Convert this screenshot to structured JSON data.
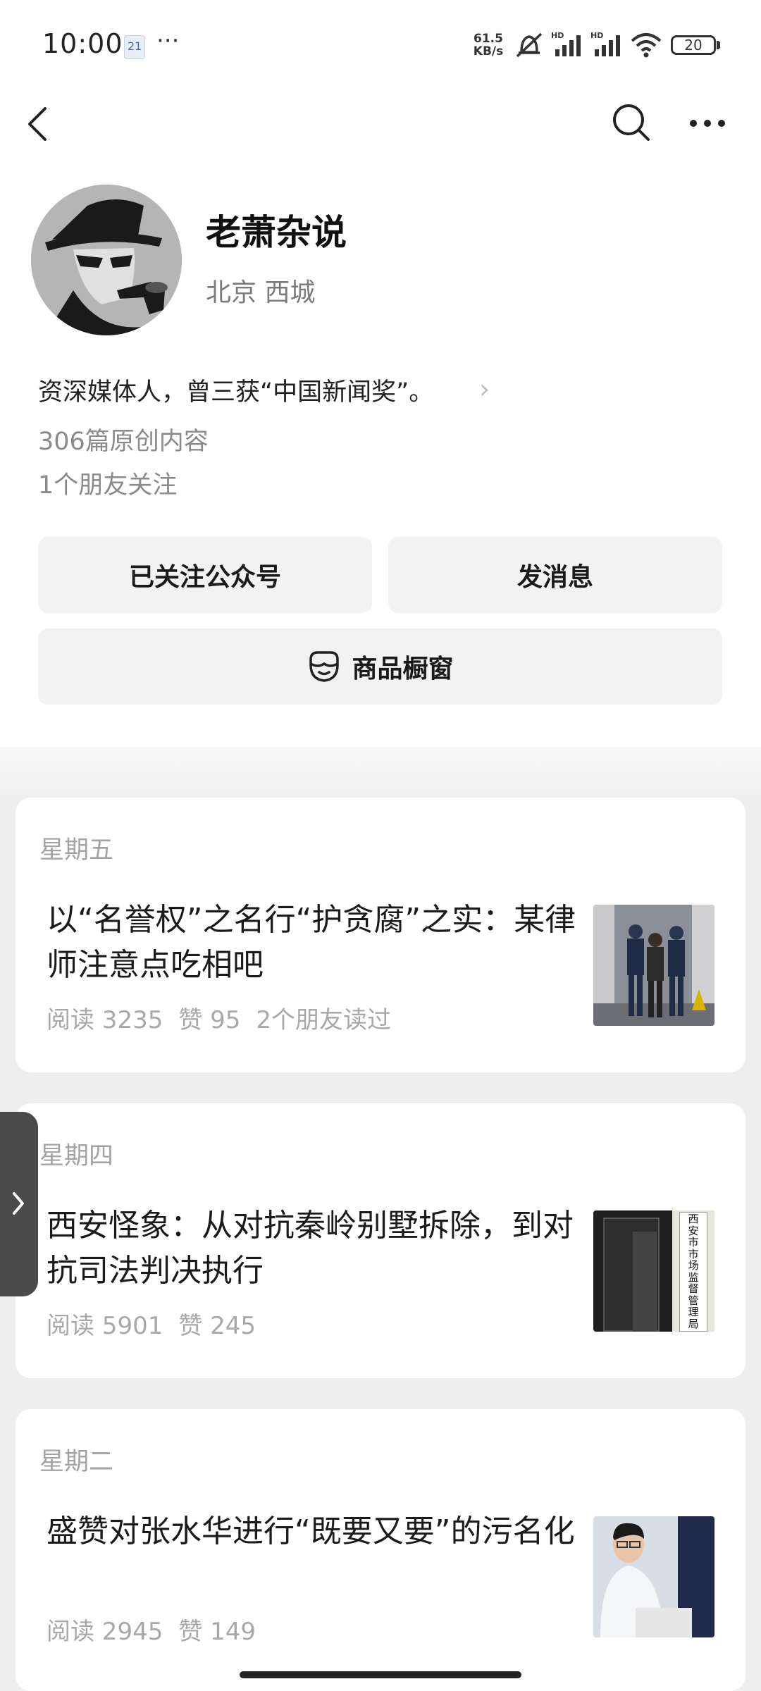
{
  "status_bar": {
    "time": "10:00",
    "calendar_badge": "21",
    "speed_top": "61.5",
    "speed_bottom": "KB/s",
    "battery": "20"
  },
  "profile": {
    "name": "老萧杂说",
    "location": "北京 西城",
    "bio": "资深媒体人，曾三获“中国新闻奖”。",
    "original_count": "306篇原创内容",
    "friends_follow": "1个朋友关注"
  },
  "actions": {
    "follow": "已关注公众号",
    "message": "发消息",
    "shop": "商品橱窗"
  },
  "articles": [
    {
      "day": "星期五",
      "title": "以“名誉权”之名行“护贪腐”之实：某律师注意点吃相吧",
      "reads": "阅读 3235",
      "likes": "赞 95",
      "friends": "2个朋友读过"
    },
    {
      "day": "星期四",
      "title": "西安怪象：从对抗秦岭别墅拆除，到对抗司法判决执行",
      "reads": "阅读 5901",
      "likes": "赞 245",
      "sign_text": "西安市市场监督管理局"
    },
    {
      "day": "星期二",
      "title": "盛赞对张水华进行“既要又要”的污名化",
      "reads": "阅读 2945",
      "likes": "赞 149"
    }
  ]
}
